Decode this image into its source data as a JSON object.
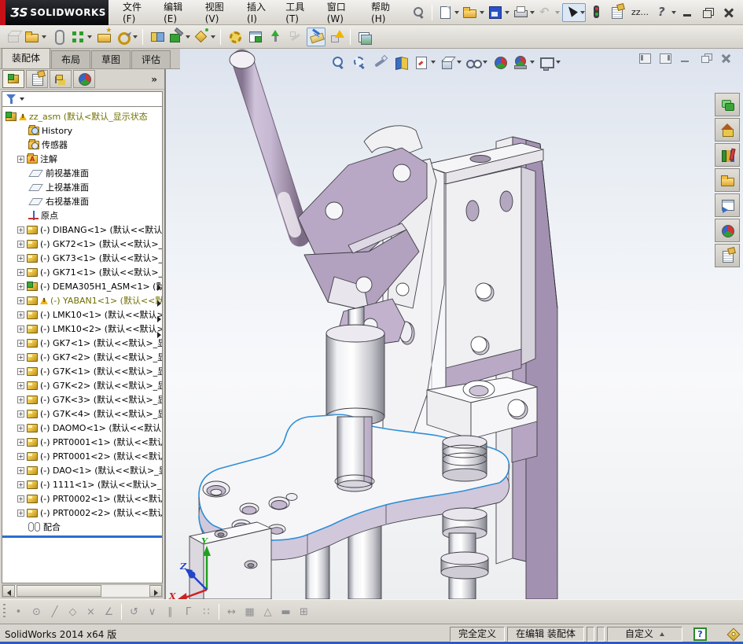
{
  "window": {
    "brand_mark": "ƷS",
    "brand": "SOLIDWORKS",
    "doc_short": "zz...",
    "controls": [
      "minimize",
      "restore",
      "close"
    ]
  },
  "menubar": {
    "items": [
      "文件(F)",
      "编辑(E)",
      "视图(V)",
      "插入(I)",
      "工具(T)",
      "窗口(W)",
      "帮助(H)"
    ]
  },
  "quick_toolbar": {
    "items": [
      {
        "name": "search-pin"
      },
      {
        "sep": true
      },
      {
        "name": "new-document",
        "dropdown": true
      },
      {
        "name": "open",
        "dropdown": true
      },
      {
        "name": "save",
        "dropdown": true
      },
      {
        "name": "print",
        "dropdown": true
      },
      {
        "name": "undo",
        "dropdown": true,
        "disabled": true
      },
      {
        "name": "select-cursor",
        "dropdown": true,
        "active": true
      },
      {
        "name": "rebuild-traffic-light"
      },
      {
        "name": "file-properties"
      },
      {
        "text": "zz..."
      },
      {
        "name": "help",
        "dropdown": true
      }
    ]
  },
  "assembly_toolbar": {
    "items": [
      {
        "name": "insert-component",
        "disabled": true
      },
      {
        "name": "insert-components",
        "dropdown": true
      },
      {
        "name": "mate"
      },
      {
        "name": "linear-component-pattern",
        "dropdown": true
      },
      {
        "name": "smart-fasteners"
      },
      {
        "name": "move-component",
        "dropdown": true
      },
      {
        "sep": true
      },
      {
        "name": "show-hidden-components"
      },
      {
        "name": "assembly-features",
        "dropdown": true
      },
      {
        "name": "reference-geometry",
        "dropdown": true
      },
      {
        "sep": true
      },
      {
        "name": "new-motion-study"
      },
      {
        "name": "bill-of-materials"
      },
      {
        "name": "exploded-view"
      },
      {
        "name": "explode-line-sketch",
        "disabled": true
      },
      {
        "name": "instant3d",
        "active": true
      },
      {
        "name": "large-design-review"
      },
      {
        "sep": true
      },
      {
        "name": "preview-window"
      }
    ]
  },
  "command_tabs": {
    "items": [
      {
        "label": "装配体",
        "active": true
      },
      {
        "label": "布局",
        "active": false
      },
      {
        "label": "草图",
        "active": false
      },
      {
        "label": "评估",
        "active": false
      }
    ],
    "overflow": "»"
  },
  "panel": {
    "tabs": [
      {
        "name": "featuremanager-design-tree",
        "active": true
      },
      {
        "name": "propertymanager",
        "active": false
      },
      {
        "name": "configurationmanager",
        "active": false
      },
      {
        "name": "displaymanager",
        "active": false
      }
    ],
    "overflow": "»"
  },
  "feature_tree": {
    "items": [
      {
        "icon": "assembly",
        "warning": true,
        "olive": true,
        "label": "zz_asm (默认<默认_显示状态",
        "root": true
      },
      {
        "icon": "history",
        "label": "History"
      },
      {
        "icon": "sensors",
        "label": "传感器"
      },
      {
        "icon": "annotations",
        "plus": true,
        "label": "注解"
      },
      {
        "icon": "plane",
        "label": "前视基准面"
      },
      {
        "icon": "plane",
        "label": "上视基准面"
      },
      {
        "icon": "plane",
        "label": "右视基准面"
      },
      {
        "icon": "origin",
        "label": "原点"
      },
      {
        "icon": "part",
        "plus": true,
        "label": "(-) DIBANG<1> (默认<<默认>"
      },
      {
        "icon": "part",
        "plus": true,
        "label": "(-) GK72<1> (默认<<默认>_显"
      },
      {
        "icon": "part",
        "plus": true,
        "label": "(-) GK73<1> (默认<<默认>_显"
      },
      {
        "icon": "part",
        "plus": true,
        "label": "(-) GK71<1> (默认<<默认>_显"
      },
      {
        "icon": "assembly",
        "plus": true,
        "label": "(-) DEMA305H1_ASM<1> (默认"
      },
      {
        "icon": "part",
        "plus": true,
        "warning": true,
        "olive": true,
        "label": "(-) YABAN1<1> (默认<<默"
      },
      {
        "icon": "part",
        "plus": true,
        "label": "(-) LMK10<1> (默认<<默认>_"
      },
      {
        "icon": "part",
        "plus": true,
        "label": "(-) LMK10<2> (默认<<默认>_"
      },
      {
        "icon": "part",
        "plus": true,
        "label": "(-) GK7<1> (默认<<默认>_显"
      },
      {
        "icon": "part",
        "plus": true,
        "label": "(-) GK7<2> (默认<<默认>_显"
      },
      {
        "icon": "part",
        "plus": true,
        "label": "(-) G7K<1> (默认<<默认>_显"
      },
      {
        "icon": "part",
        "plus": true,
        "label": "(-) G7K<2> (默认<<默认>_显"
      },
      {
        "icon": "part",
        "plus": true,
        "label": "(-) G7K<3> (默认<<默认>_显"
      },
      {
        "icon": "part",
        "plus": true,
        "label": "(-) G7K<4> (默认<<默认>_显"
      },
      {
        "icon": "part",
        "plus": true,
        "label": "(-) DAOMO<1> (默认<<默认>"
      },
      {
        "icon": "part",
        "plus": true,
        "label": "(-) PRT0001<1> (默认<<默认"
      },
      {
        "icon": "part",
        "plus": true,
        "label": "(-) PRT0001<2> (默认<<默认"
      },
      {
        "icon": "part",
        "plus": true,
        "label": "(-) DAO<1> (默认<<默认>_显"
      },
      {
        "icon": "part",
        "plus": true,
        "label": "(-) 1111<1> (默认<<默认>_显"
      },
      {
        "icon": "part",
        "plus": true,
        "label": "(-) PRT0002<1> (默认<<默认"
      },
      {
        "icon": "part",
        "plus": true,
        "label": "(-) PRT0002<2> (默认<<默认"
      },
      {
        "icon": "mates",
        "label": "配合"
      }
    ]
  },
  "headsup_toolbar": {
    "items": [
      {
        "name": "zoom-to-fit"
      },
      {
        "name": "zoom-to-area"
      },
      {
        "name": "previous-view"
      },
      {
        "name": "section-view"
      },
      {
        "name": "view-orientation",
        "dropdown": true
      },
      {
        "name": "display-style",
        "dropdown": true
      },
      {
        "name": "hide-show-items",
        "dropdown": true
      },
      {
        "name": "edit-appearance"
      },
      {
        "name": "apply-scene",
        "dropdown": true
      },
      {
        "name": "view-settings",
        "dropdown": true
      }
    ]
  },
  "viewport_controls": {
    "items": [
      {
        "name": "collapse-left-pane"
      },
      {
        "name": "collapse-right-pane"
      },
      {
        "name": "minimize-doc"
      },
      {
        "name": "restore-doc"
      },
      {
        "name": "close-doc"
      }
    ]
  },
  "task_pane": {
    "items": [
      {
        "name": "solidworks-forum"
      },
      {
        "name": "solidworks-resources"
      },
      {
        "name": "design-library"
      },
      {
        "name": "file-explorer"
      },
      {
        "name": "view-palette"
      },
      {
        "name": "appearances-scenes"
      },
      {
        "name": "custom-properties"
      }
    ]
  },
  "sketch_toolbar": {
    "items": [
      {
        "name": "sketch-point",
        "glyph": "•"
      },
      {
        "name": "sketch-circle",
        "glyph": "⊙"
      },
      {
        "name": "sketch-line",
        "glyph": "╱"
      },
      {
        "name": "sketch-polygon",
        "glyph": "◇"
      },
      {
        "name": "sketch-trim",
        "glyph": "×"
      },
      {
        "name": "sketch-chamfer",
        "glyph": "∠"
      },
      {
        "sep": true
      },
      {
        "name": "add-relation",
        "glyph": "↺"
      },
      {
        "name": "mirror-entities",
        "glyph": "∨"
      },
      {
        "name": "offset-entities",
        "glyph": "∥"
      },
      {
        "name": "corner-rectangle",
        "glyph": "Γ"
      },
      {
        "name": "linear-sketch-pattern",
        "glyph": "∷"
      },
      {
        "sep": true
      },
      {
        "name": "smart-dimension",
        "glyph": "↔"
      },
      {
        "name": "grid-snap",
        "glyph": "▦"
      },
      {
        "name": "measure-angle",
        "glyph": "△"
      },
      {
        "name": "rectangle-tool",
        "glyph": "▬"
      },
      {
        "name": "table-tool",
        "glyph": "⊞"
      }
    ]
  },
  "status_bar": {
    "app_version": "SolidWorks 2014 x64 版",
    "define_state": "完全定义",
    "edit_state": "在编辑 装配体",
    "custom_label": "自定义",
    "help_glyph": "?"
  },
  "triad": {
    "x": "X",
    "y": "Y",
    "z": "Z",
    "x_color": "#cc2222",
    "y_color": "#1ea21e",
    "z_color": "#2244cc"
  },
  "colors": {
    "selection_blue": "#2e8fd8",
    "model_lavender": "#b6a6c2",
    "warning_text": "#6f6f00"
  }
}
